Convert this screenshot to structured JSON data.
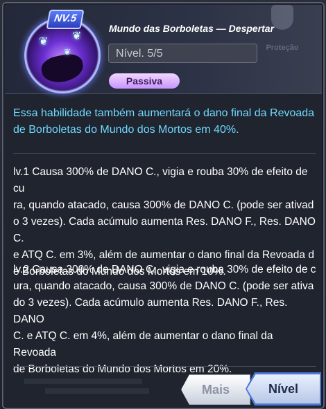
{
  "skill": {
    "level_badge": "NV.5",
    "title": "Mundo das Borboletas — Despertar",
    "level_text": "Nível. 5/5",
    "type_label": "Passiva"
  },
  "background_ui": {
    "protection_label": "Proteção"
  },
  "description": {
    "highlight": "Essa habilidade também aumentará o dano final da Revoada de Borboletas do Mundo dos Mortos em 40%.",
    "levels": [
      {
        "lines": [
          "lv.1 Causa 300% de DANO C., vigia e rouba 30% de efeito de cu",
          "ra, quando atacado, causa 300% de DANO C. (pode ser ativad",
          "o 3 vezes). Cada acúmulo aumenta Res. DANO F., Res. DANO C.",
          "e ATQ C. em 3%, além de aumentar o dano final da Revoada d",
          "e Borboletas do Mundo dos Mortos em 10%."
        ]
      },
      {
        "lines": [
          "lv.2 Causa 300% de DANO C., vigia e rouba 30% de efeito de c",
          "ura, quando atacado, causa 300% de DANO C. (pode ser ativa",
          "do 3 vezes). Cada acúmulo aumenta Res. DANO F., Res. DANO",
          "C. e ATQ C. em 4%, além de aumentar o dano final da Revoada",
          "de Borboletas do Mundo dos Mortos em 20%."
        ]
      }
    ]
  },
  "buttons": {
    "more_label": "Mais",
    "level_label": "Nível"
  },
  "colors": {
    "highlight_text": "#6fd9ff",
    "body_text": "#ffffff",
    "passive_pill": "#d9b3ff",
    "level_button_border": "#4a78d8"
  },
  "icons": {
    "skill_icon": "butterfly-hand-icon",
    "protection_icon": "shield-icon"
  }
}
